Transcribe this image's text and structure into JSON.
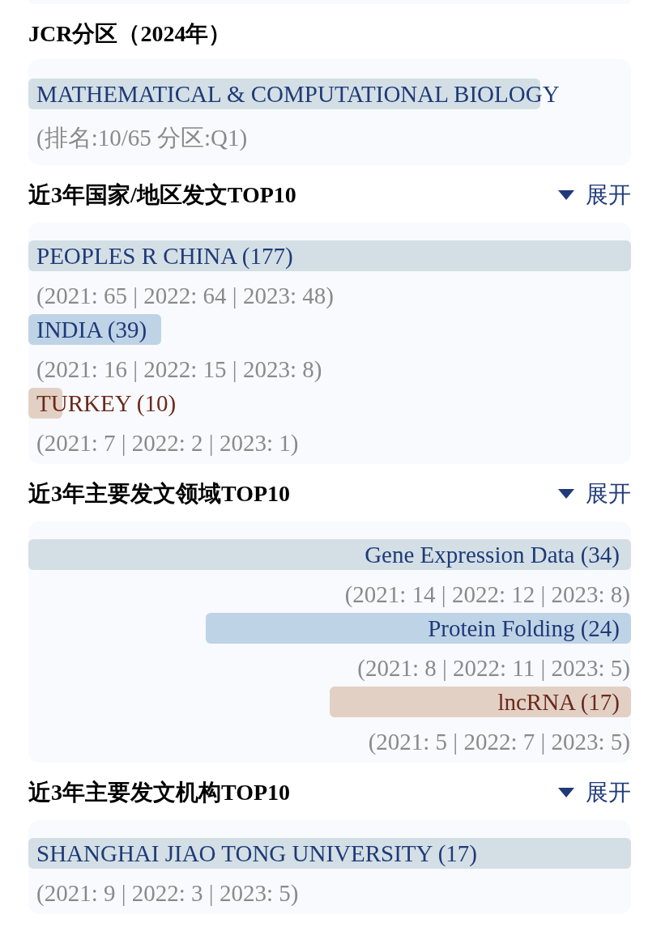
{
  "jcr": {
    "title": "JCR分区（2024年）",
    "category": {
      "name": "MATHEMATICAL & COMPUTATIONAL BIOLOGY",
      "level": 0.85,
      "color": "#d3dfe5"
    },
    "rank": "(排名:10/65 分区:Q1)"
  },
  "countries": {
    "title": "近3年国家/地区发文TOP10",
    "toggle": {
      "label": "展开",
      "expanded": false
    },
    "items": [
      {
        "name": "PEOPLES R CHINA (177)",
        "level": 1,
        "color": "#d3dfe5",
        "years": "(2021: 65 | 2022: 64 | 2023: 48)"
      },
      {
        "name": "INDIA (39)",
        "level": 0.22,
        "color": "#bfd3e6",
        "years": "(2021: 16 | 2022: 15 | 2023: 8)"
      },
      {
        "name": "TURKEY (10)",
        "level": 0.056,
        "color": "#e3d0c5",
        "years": "(2021: 7 | 2022: 2 | 2023: 1)"
      }
    ]
  },
  "fields": {
    "title": "近3年主要发文领域TOP10",
    "toggle": {
      "label": "展开",
      "expanded": false
    },
    "items": [
      {
        "name": "Gene Expression Data (34)",
        "level": 1,
        "color": "#d3dfe5",
        "years": "(2021: 14 | 2022: 12 | 2023: 8)"
      },
      {
        "name": "Protein Folding (24)",
        "level": 0.706,
        "color": "#bfd3e6",
        "years": "(2021: 8 | 2022: 11 | 2023: 5)"
      },
      {
        "name": "lncRNA (17)",
        "level": 0.5,
        "color": "#e3d0c5",
        "years": "(2021: 5 | 2022: 7 | 2023: 5)"
      }
    ]
  },
  "institutions": {
    "title": "近3年主要发文机构TOP10",
    "toggle": {
      "label": "展开",
      "expanded": false
    },
    "items": [
      {
        "name": "SHANGHAI JIAO TONG UNIVERSITY (17)",
        "level": 1,
        "color": "#d3dfe5",
        "years": "(2021: 9 | 2022: 3 | 2023: 5)"
      }
    ]
  }
}
